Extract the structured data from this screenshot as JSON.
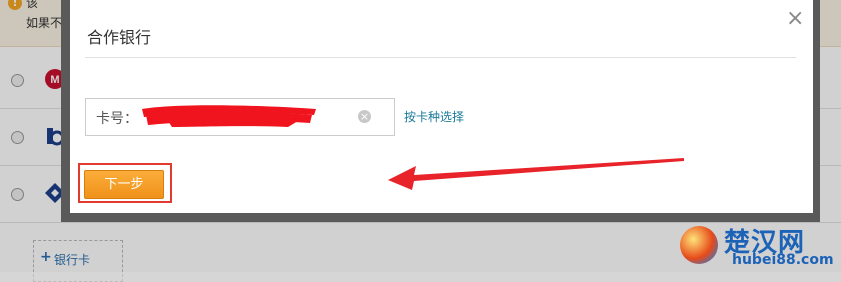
{
  "background": {
    "notice_line1": "该",
    "notice_line2": "如果不",
    "add_card_label": "银行卡",
    "add_card_plus": "+"
  },
  "modal": {
    "title": "合作银行",
    "close_symbol": "×",
    "card_label": "卡号：",
    "card_value": "",
    "clear_symbol": "×",
    "select_by_type_link": "按卡种选择",
    "next_button": "下一步"
  },
  "watermark": {
    "cn": "楚汉网",
    "en": "hubei88.com"
  },
  "colors": {
    "accent_orange": "#f5a02a",
    "highlight_red": "#e23a2e",
    "link_teal": "#1a7a9a",
    "watermark_blue": "#1c63b8"
  },
  "icons": {
    "close": "close-icon",
    "clear": "clear-input-icon",
    "warning": "warning-icon"
  }
}
